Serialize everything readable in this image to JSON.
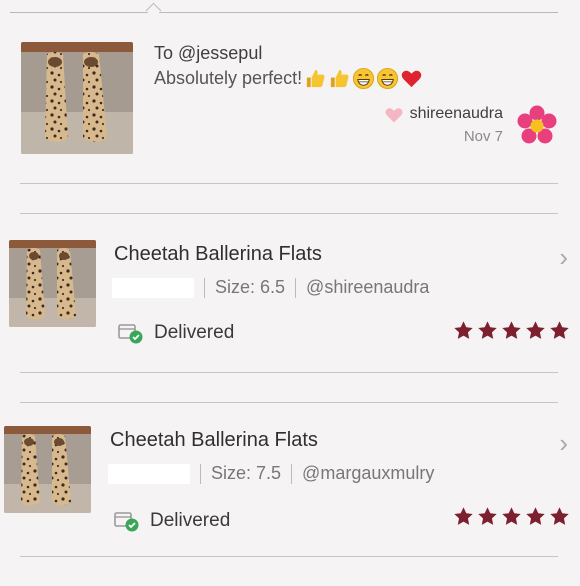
{
  "comment": {
    "to": "To @jessepul",
    "message": "Absolutely perfect!",
    "emojis": [
      "thumbs-up",
      "thumbs-up",
      "grin",
      "grin",
      "heart"
    ],
    "author": "shireenaudra",
    "date": "Nov 7"
  },
  "orders": [
    {
      "title": "Cheetah Ballerina Flats",
      "size": "Size: 6.5",
      "user": "@shireenaudra",
      "status": "Delivered",
      "rating": 5
    },
    {
      "title": "Cheetah Ballerina Flats",
      "size": "Size: 7.5",
      "user": "@margauxmulry",
      "status": "Delivered",
      "rating": 5
    }
  ],
  "colors": {
    "star": "#7c1f2e",
    "check": "#3aa65a",
    "heart_light": "#f3b6c2",
    "flower_petal": "#e8407e",
    "flower_center": "#f6c11d"
  }
}
